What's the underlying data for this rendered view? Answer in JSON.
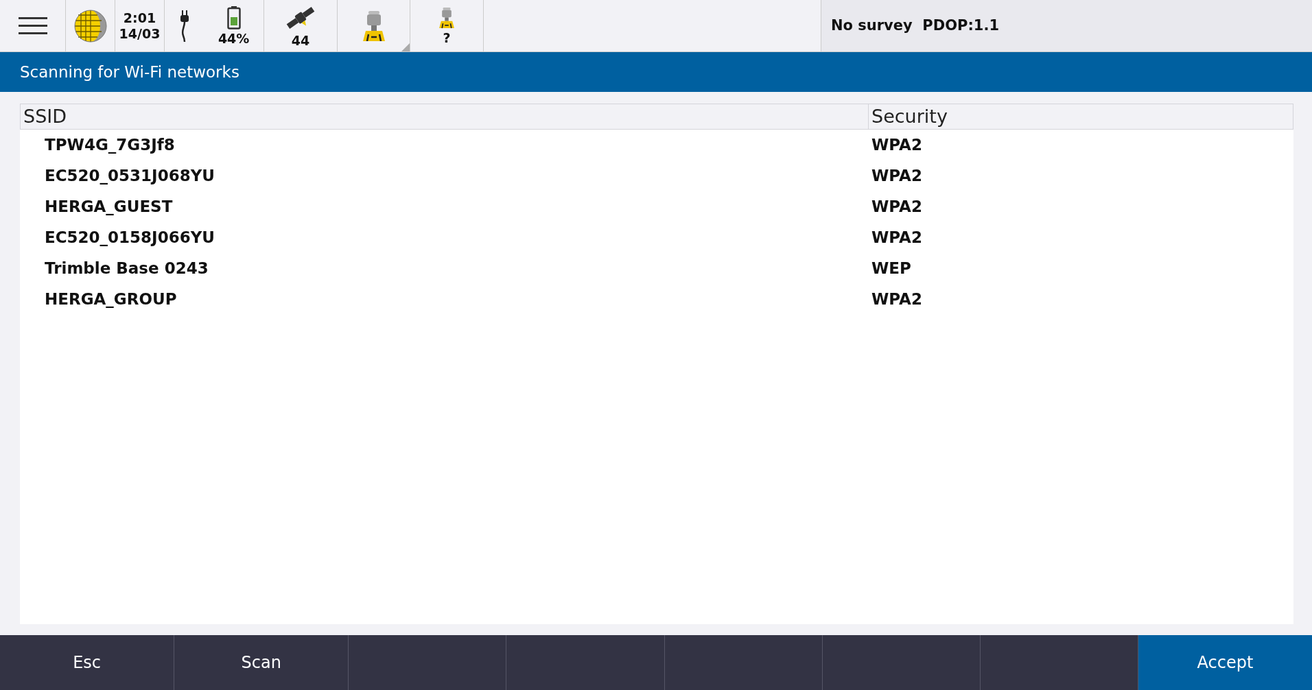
{
  "status_bar": {
    "time": "2:01",
    "date": "14/03",
    "battery": "44%",
    "satellites": "44",
    "receiver_status": "?",
    "survey": "No survey  PDOP:1.1"
  },
  "title": "Scanning for Wi-Fi networks",
  "table": {
    "columns": [
      "SSID",
      "Security"
    ],
    "rows": [
      [
        "TPW4G_7G3Jf8",
        "WPA2"
      ],
      [
        "EC520_0531J068YU",
        "WPA2"
      ],
      [
        "HERGA_GUEST",
        "WPA2"
      ],
      [
        "EC520_0158J066YU",
        "WPA2"
      ],
      [
        "Trimble Base 0243",
        "WEP"
      ],
      [
        "HERGA_GROUP",
        "WPA2"
      ]
    ]
  },
  "softkeys": [
    {
      "kind": "plain",
      "label": "Esc"
    },
    {
      "kind": "plain",
      "label": "Scan"
    },
    {
      "kind": "blank"
    },
    {
      "kind": "blank"
    },
    {
      "kind": "blank"
    },
    {
      "kind": "blank"
    },
    {
      "kind": "blank"
    },
    {
      "kind": "primary",
      "label": "Accept"
    }
  ]
}
